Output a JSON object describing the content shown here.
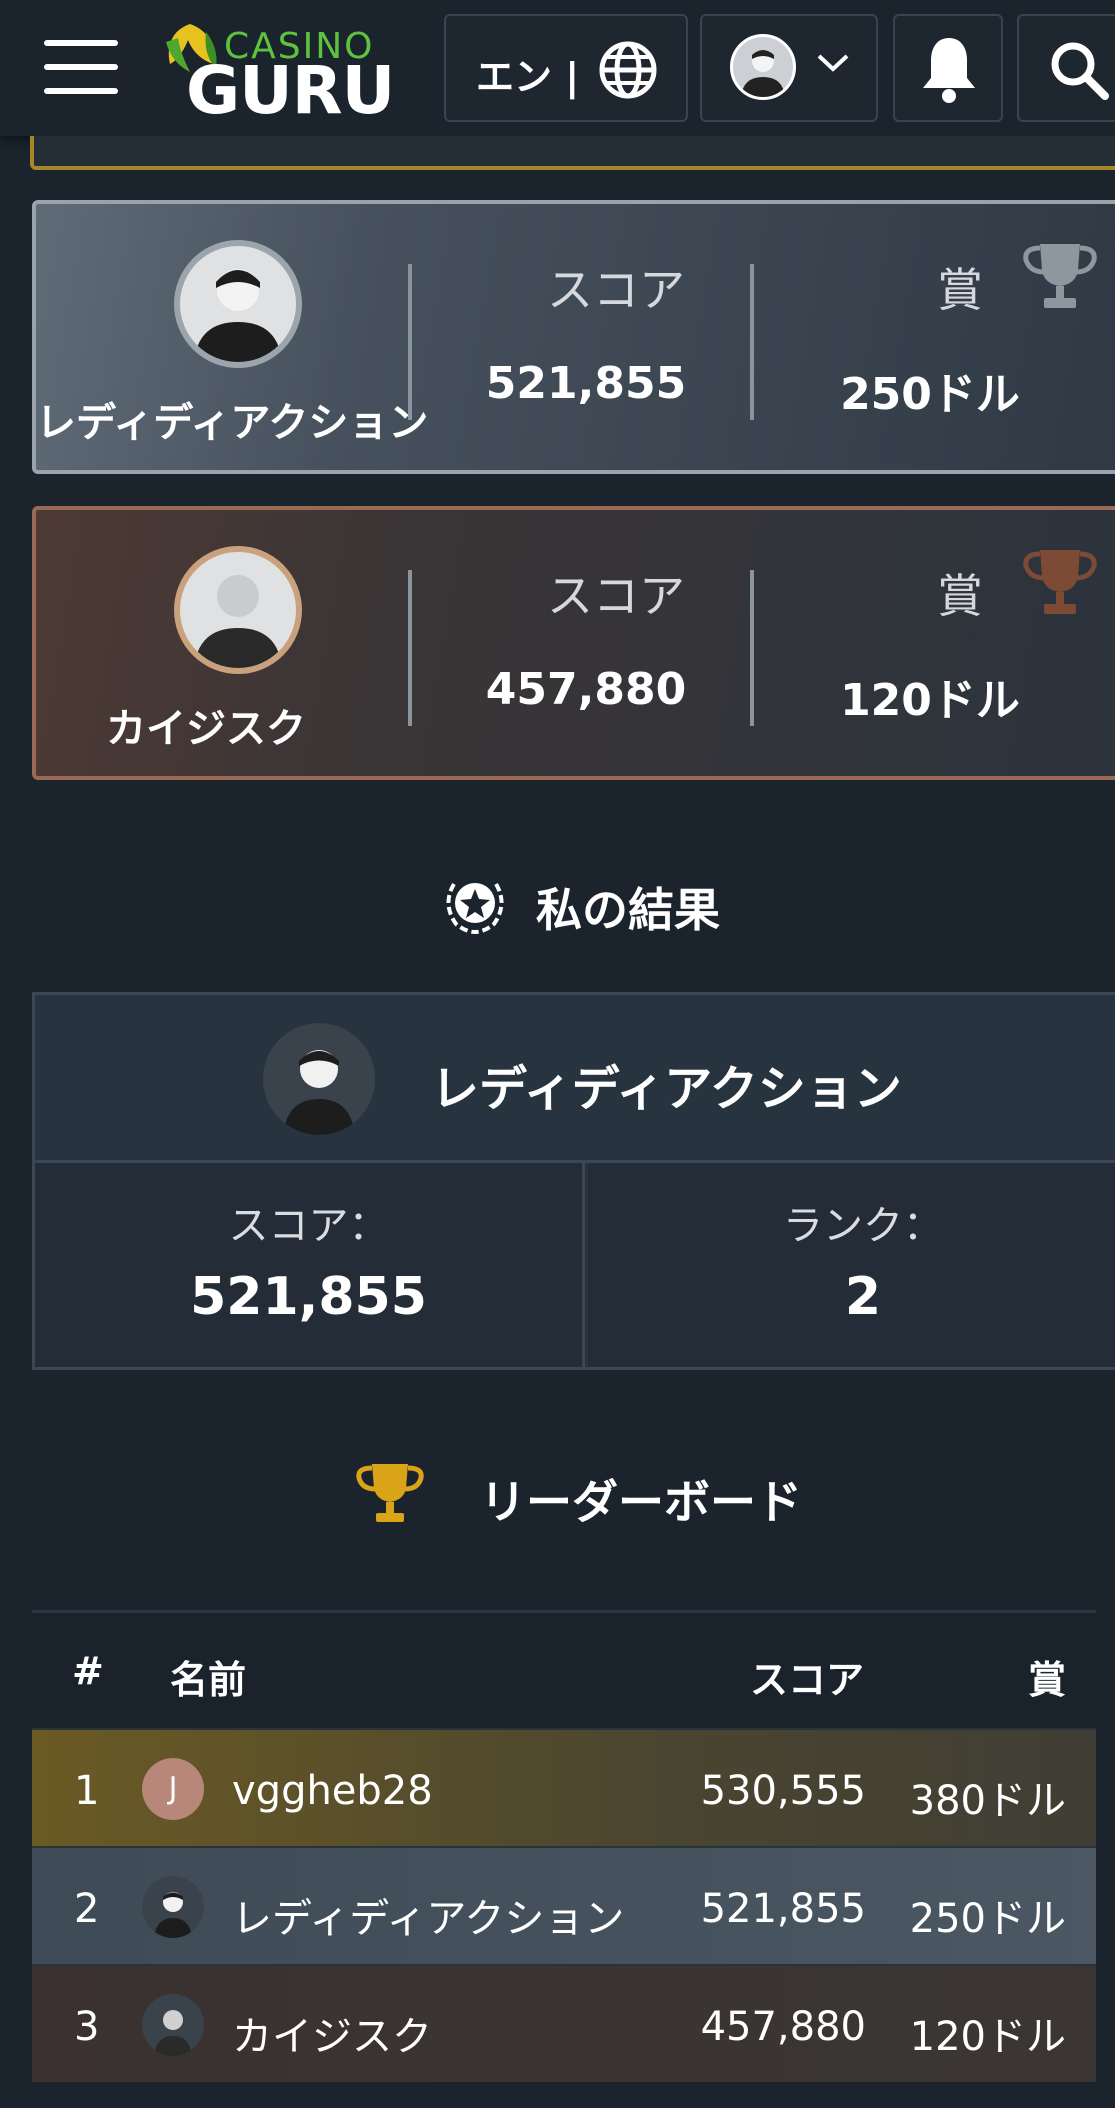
{
  "header": {
    "logo_top": "CASINO",
    "logo_bottom": "GURU",
    "language_label": "エン |",
    "icons": [
      "menu-icon",
      "globe-icon",
      "avatar",
      "chevron-down-icon",
      "bell-icon",
      "search-icon"
    ]
  },
  "podium": [
    {
      "name": "レディディアクション",
      "score_label": "スコア",
      "score": "521,855",
      "prize_label": "賞",
      "prize": "250ドル",
      "trophy_color": "#8e979e"
    },
    {
      "name": "カイジスク",
      "score_label": "スコア",
      "score": "457,880",
      "prize_label": "賞",
      "prize": "120ドル",
      "trophy_color": "#7d4a35"
    }
  ],
  "my_results": {
    "title": "私の結果",
    "name": "レディディアクション",
    "score_label": "スコア：",
    "score": "521,855",
    "rank_label": "ランク：",
    "rank": "2"
  },
  "leaderboard": {
    "title": "リーダーボード",
    "columns": {
      "rank": "#",
      "name": "名前",
      "score": "スコア",
      "prize": "賞"
    },
    "rows": [
      {
        "rank": "1",
        "avatar_letter": "J",
        "name": "vggheb28",
        "score": "530,555",
        "prize": "380ドル"
      },
      {
        "rank": "2",
        "avatar_letter": "",
        "name": "レディディアクション",
        "score": "521,855",
        "prize": "250ドル"
      },
      {
        "rank": "3",
        "avatar_letter": "",
        "name": "カイジスク",
        "score": "457,880",
        "prize": "120ドル"
      }
    ]
  },
  "colors": {
    "background": "#1b232d",
    "gold": "#a5862a",
    "trophy_gold": "#d9a418",
    "logo_green": "#5ec23c"
  }
}
